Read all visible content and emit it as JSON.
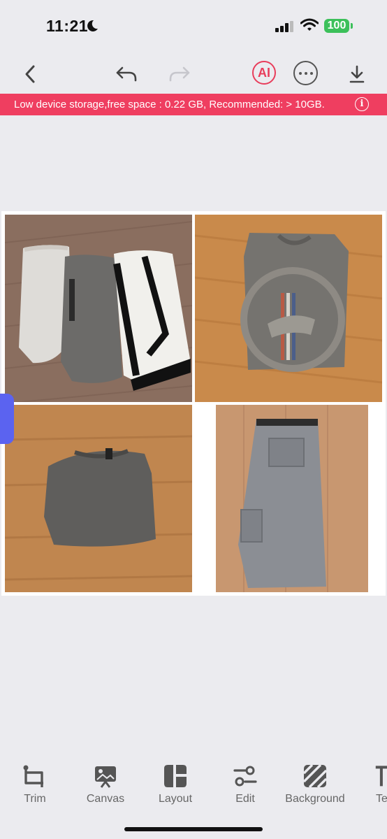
{
  "status_bar": {
    "time": "11:21",
    "battery": "100"
  },
  "toolbar": {
    "back_icon": "chevron-left-icon",
    "undo_icon": "undo-icon",
    "redo_icon": "redo-icon",
    "ai_label": "AI",
    "more_icon": "ellipsis-icon",
    "download_icon": "download-icon"
  },
  "banner": {
    "text": "Low device storage,free space : 0.22 GB,  Recommended: > 10GB.",
    "info_icon": "i",
    "color": "#ef3e60"
  },
  "collage": {
    "tiles": [
      {
        "name": "shorts-group-photo"
      },
      {
        "name": "mustang-tshirt-photo"
      },
      {
        "name": "gray-sweater-photo"
      },
      {
        "name": "cargo-shorts-photo"
      }
    ]
  },
  "tools": {
    "items": [
      {
        "label": "Trim",
        "icon": "crop-icon"
      },
      {
        "label": "Canvas",
        "icon": "canvas-icon"
      },
      {
        "label": "Layout",
        "icon": "layout-icon"
      },
      {
        "label": "Edit",
        "icon": "sliders-icon"
      },
      {
        "label": "Background",
        "icon": "pattern-icon"
      },
      {
        "label": "Te",
        "icon": "text-icon"
      }
    ]
  },
  "colors": {
    "accent": "#e83d5b",
    "handle": "#5b63f0",
    "background": "#ebebef"
  }
}
